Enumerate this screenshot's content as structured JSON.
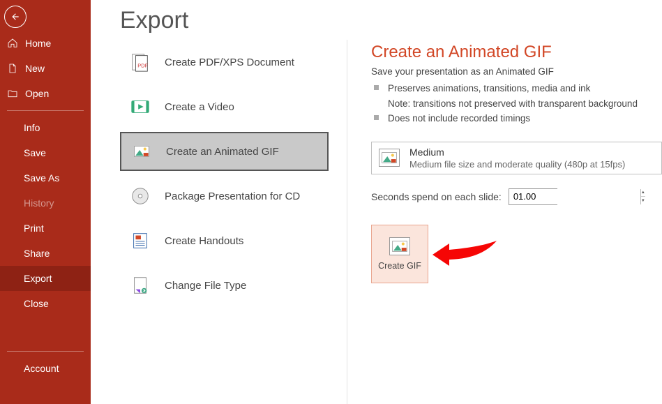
{
  "sidebar": {
    "primary": [
      {
        "label": "Home"
      },
      {
        "label": "New"
      },
      {
        "label": "Open"
      }
    ],
    "secondary": [
      {
        "label": "Info"
      },
      {
        "label": "Save"
      },
      {
        "label": "Save As"
      },
      {
        "label": "History",
        "disabled": true
      },
      {
        "label": "Print"
      },
      {
        "label": "Share"
      },
      {
        "label": "Export",
        "active": true
      },
      {
        "label": "Close"
      }
    ],
    "footer": [
      {
        "label": "Account"
      }
    ]
  },
  "page": {
    "title": "Export"
  },
  "export_options": [
    {
      "label": "Create PDF/XPS Document"
    },
    {
      "label": "Create a Video"
    },
    {
      "label": "Create an Animated GIF",
      "active": true
    },
    {
      "label": "Package Presentation for CD"
    },
    {
      "label": "Create Handouts"
    },
    {
      "label": "Change File Type"
    }
  ],
  "details": {
    "title": "Create an Animated GIF",
    "subtitle": "Save your presentation as an Animated GIF",
    "bullets": [
      "Preserves animations, transitions, media and ink",
      "Note: transitions not preserved with transparent background",
      "Does not include recorded timings"
    ],
    "quality": {
      "label": "Medium",
      "description": "Medium file size and moderate quality (480p at 15fps)"
    },
    "seconds_label": "Seconds spend on each slide:",
    "seconds_value": "01.00",
    "create_label": "Create GIF"
  }
}
